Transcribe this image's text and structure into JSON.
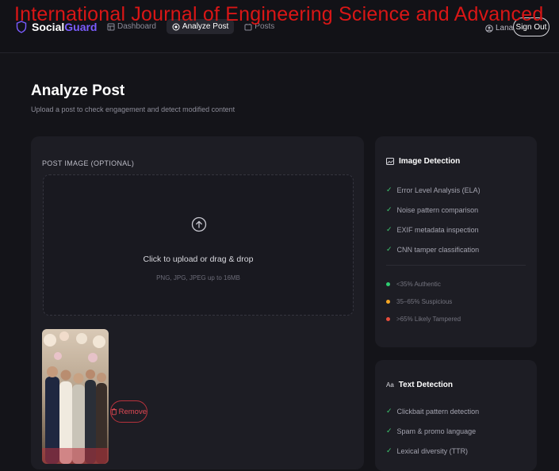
{
  "watermark": "International Journal of Engineering Science and Advanced",
  "app": {
    "brand_part1": "Social",
    "brand_part2": "Guard",
    "brand_color": "#7b5cff"
  },
  "nav": {
    "items": [
      {
        "label": "Dashboard",
        "icon": "dashboard-icon",
        "active": false
      },
      {
        "label": "Analyze Post",
        "icon": "analyze-icon",
        "active": true
      },
      {
        "label": "Posts",
        "icon": "posts-icon",
        "active": false
      }
    ]
  },
  "user": {
    "name": "Lana",
    "signout_label": "Sign Out"
  },
  "page": {
    "title": "Analyze Post",
    "subtitle": "Upload a post to check engagement and detect modified content"
  },
  "upload": {
    "section_label": "POST IMAGE (OPTIONAL)",
    "title": "Click to upload or drag & drop",
    "hint": "PNG, JPG, JPEG up to 16MB",
    "remove_label": "Remove"
  },
  "image_detection": {
    "title": "Image Detection",
    "checks": [
      "Error Level Analysis (ELA)",
      "Noise pattern comparison",
      "EXIF metadata inspection",
      "CNN tamper classification"
    ],
    "legend": [
      {
        "label": "<35% Authentic",
        "color": "#2ecc71"
      },
      {
        "label": "35–65% Suspicious",
        "color": "#f5a623"
      },
      {
        "label": ">65% Likely Tampered",
        "color": "#e74c3c"
      }
    ]
  },
  "text_detection": {
    "title": "Text Detection",
    "checks": [
      "Clickbait pattern detection",
      "Spam & promo language",
      "Lexical diversity (TTR)"
    ]
  }
}
